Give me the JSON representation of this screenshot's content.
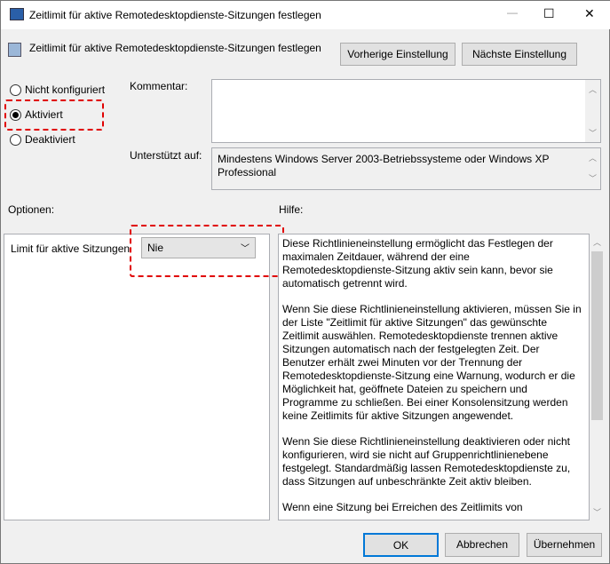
{
  "window": {
    "title": "Zeitlimit für aktive Remotedesktopdienste-Sitzungen festlegen",
    "minimize": "—",
    "maximize": "☐",
    "close": "✕"
  },
  "header": {
    "policy_name": "Zeitlimit für aktive Remotedesktopdienste-Sitzungen festlegen",
    "prev_button": "Vorherige Einstellung",
    "next_button": "Nächste Einstellung"
  },
  "state": {
    "options": [
      "Nicht konfiguriert",
      "Aktiviert",
      "Deaktiviert"
    ],
    "selected": "Aktiviert"
  },
  "comment": {
    "label": "Kommentar:",
    "value": ""
  },
  "supported": {
    "label": "Unterstützt auf:",
    "value": "Mindestens Windows Server 2003-Betriebssysteme oder Windows XP Professional"
  },
  "options_section": {
    "label": "Optionen:",
    "field_label": "Limit für aktive Sitzungen",
    "select_value": "Nie"
  },
  "help": {
    "label": "Hilfe:",
    "paragraphs": [
      "Diese Richtlinieneinstellung ermöglicht das Festlegen der maximalen Zeitdauer, während der eine Remotedesktopdienste-Sitzung aktiv sein kann, bevor sie automatisch getrennt wird.",
      "Wenn Sie diese Richtlinieneinstellung aktivieren, müssen Sie in der Liste \"Zeitlimit für aktive Sitzungen\" das gewünschte Zeitlimit auswählen. Remotedesktopdienste trennen aktive Sitzungen automatisch nach der festgelegten Zeit. Der Benutzer erhält zwei Minuten vor der Trennung der Remotedesktopdienste-Sitzung eine Warnung, wodurch er die Möglichkeit hat, geöffnete Dateien zu speichern und Programme zu schließen. Bei einer Konsolensitzung werden keine Zeitlimits für aktive Sitzungen angewendet.",
      "Wenn Sie diese Richtlinieneinstellung deaktivieren oder nicht konfigurieren, wird sie nicht auf Gruppenrichtlinienebene festgelegt. Standardmäßig lassen Remotedesktopdienste zu, dass Sitzungen auf unbeschränkte Zeit aktiv bleiben.",
      "Wenn eine Sitzung bei Erreichen des Zeitlimits von"
    ]
  },
  "footer": {
    "ok": "OK",
    "cancel": "Abbrechen",
    "apply": "Übernehmen"
  }
}
